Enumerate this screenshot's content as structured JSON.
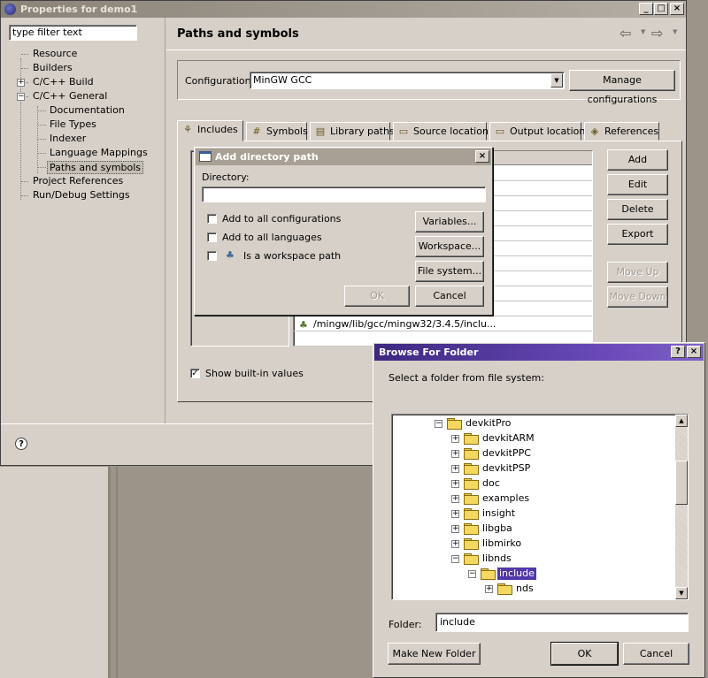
{
  "window": {
    "title": "Properties for demo1",
    "controls": {
      "minimize": "_",
      "maximize": "□",
      "close": "×"
    }
  },
  "filter": {
    "value": "type filter text"
  },
  "nav_tree": [
    {
      "label": "Resource"
    },
    {
      "label": "Builders"
    },
    {
      "label": "C/C++ Build",
      "expander": "+"
    },
    {
      "label": "C/C++ General",
      "expander": "−"
    },
    {
      "label": "Documentation"
    },
    {
      "label": "File Types"
    },
    {
      "label": "Indexer"
    },
    {
      "label": "Language Mappings"
    },
    {
      "label": "Paths and symbols",
      "selected": true
    },
    {
      "label": "Project References"
    },
    {
      "label": "Run/Debug Settings"
    }
  ],
  "page": {
    "title": "Paths and symbols",
    "back_arrow": "⇦",
    "forward_arrow": "⇨",
    "configuration_label": "Configuration:",
    "configuration_value": "MinGW GCC",
    "manage_button": "Manage configurations"
  },
  "tabs": [
    {
      "label": "Includes",
      "icon": "includes-icon",
      "active": true
    },
    {
      "label": "Symbols",
      "icon": "hash-icon"
    },
    {
      "label": "Library paths",
      "icon": "library-icon"
    },
    {
      "label": "Source location",
      "icon": "folder-icon"
    },
    {
      "label": "Output location",
      "icon": "output-folder-icon"
    },
    {
      "label": "References",
      "icon": "references-icon"
    }
  ],
  "includes": {
    "visible_path": "/mingw/lib/gcc/mingw32/3.4.5/inclu...",
    "show_builtin_label": "Show built-in values",
    "show_builtin_checked": true,
    "buttons": {
      "add": "Add",
      "edit": "Edit",
      "delete": "Delete",
      "export": "Export",
      "move_up": "Move Up",
      "move_down": "Move Down"
    }
  },
  "help_icon": "?",
  "add_dir_dialog": {
    "title": "Add directory path",
    "directory_label": "Directory:",
    "directory_value": "",
    "checkboxes": [
      {
        "label": "Add to all configurations",
        "checked": false
      },
      {
        "label": "Add to all languages",
        "checked": false
      },
      {
        "label": "Is a workspace path",
        "checked": false
      }
    ],
    "buttons": {
      "variables": "Variables...",
      "workspace": "Workspace...",
      "filesystem": "File system...",
      "ok": "OK",
      "cancel": "Cancel"
    },
    "close": "×"
  },
  "browse_dialog": {
    "title": "Browse For Folder",
    "help_btn": "?",
    "close_btn": "×",
    "instructions": "Select a folder from file system:",
    "tree": [
      {
        "label": "devkitPro",
        "expander": "−",
        "level": 0
      },
      {
        "label": "devkitARM",
        "expander": "+",
        "level": 1
      },
      {
        "label": "devkitPPC",
        "expander": "+",
        "level": 1
      },
      {
        "label": "devkitPSP",
        "expander": "+",
        "level": 1
      },
      {
        "label": "doc",
        "expander": "+",
        "level": 1
      },
      {
        "label": "examples",
        "expander": "+",
        "level": 1
      },
      {
        "label": "insight",
        "expander": "+",
        "level": 1
      },
      {
        "label": "libgba",
        "expander": "+",
        "level": 1
      },
      {
        "label": "libmirko",
        "expander": "+",
        "level": 1
      },
      {
        "label": "libnds",
        "expander": "−",
        "level": 1
      },
      {
        "label": "include",
        "expander": "−",
        "level": 2,
        "selected": true
      },
      {
        "label": "nds",
        "expander": "+",
        "level": 3
      }
    ],
    "folder_label": "Folder:",
    "folder_value": "include",
    "buttons": {
      "new_folder": "Make New Folder",
      "ok": "OK",
      "cancel": "Cancel"
    },
    "scroll_up": "▲",
    "scroll_down": "▼"
  }
}
